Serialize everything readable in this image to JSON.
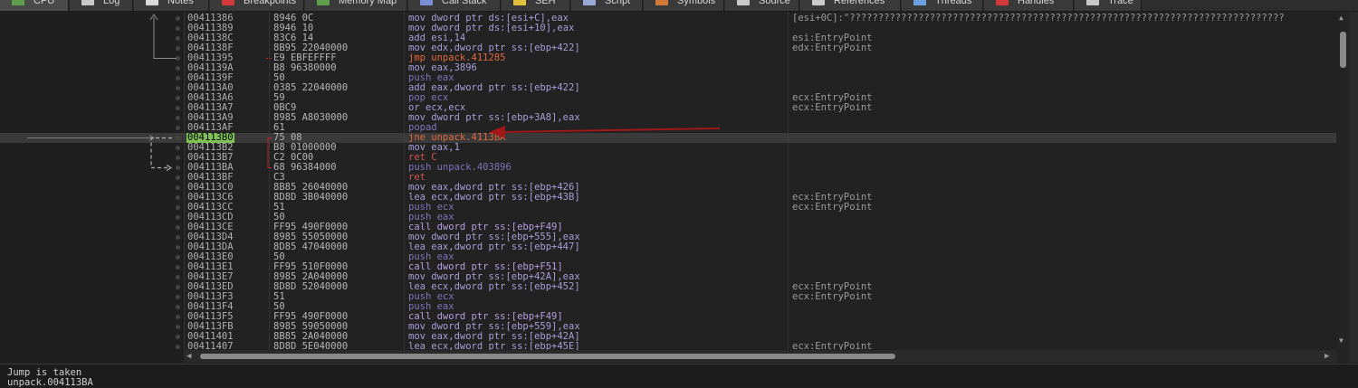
{
  "tabs": [
    {
      "label": "CPU",
      "icon": "cpu-icon",
      "color": "#5fa04e",
      "active": true
    },
    {
      "label": "Log",
      "icon": "log-icon",
      "color": "#c9c9c9",
      "active": false
    },
    {
      "label": "Notes",
      "icon": "notes-icon",
      "color": "#d9d9d9",
      "active": false
    },
    {
      "label": "Breakpoints",
      "icon": "breakpoint-icon",
      "color": "#d23a3a",
      "active": false
    },
    {
      "label": "Memory Map",
      "icon": "memory-map-icon",
      "color": "#5fa04e",
      "active": false
    },
    {
      "label": "Call Stack",
      "icon": "call-stack-icon",
      "color": "#7a8fd6",
      "active": false
    },
    {
      "label": "SEH",
      "icon": "seh-icon",
      "color": "#e2c23a",
      "active": false
    },
    {
      "label": "Script",
      "icon": "script-icon",
      "color": "#9aa8d8",
      "active": false
    },
    {
      "label": "Symbols",
      "icon": "symbols-icon",
      "color": "#d07a3a",
      "active": false
    },
    {
      "label": "Source",
      "icon": "source-icon",
      "color": "#c9c9c9",
      "active": false
    },
    {
      "label": "References",
      "icon": "references-icon",
      "color": "#c9c9c9",
      "active": false
    },
    {
      "label": "Threads",
      "icon": "threads-icon",
      "color": "#6aa0e0",
      "active": false
    },
    {
      "label": "Handles",
      "icon": "handles-icon",
      "color": "#d23a3a",
      "active": false
    },
    {
      "label": "Trace",
      "icon": "trace-icon",
      "color": "#c9c9c9",
      "active": false
    }
  ],
  "eip_label": "EIP",
  "rows": [
    {
      "addr": "00411386",
      "bytes": "8946 0C",
      "instr": "mov dword ptr ds:[esi+C],eax",
      "comment": "[esi+0C]:\"????????????????????????????????????????????????????????????????????????????"
    },
    {
      "addr": "00411389",
      "bytes": "8946 10",
      "instr": "mov dword ptr ds:[esi+10],eax",
      "comment": ""
    },
    {
      "addr": "0041138C",
      "bytes": "83C6 14",
      "instr": "add esi,14",
      "comment": "esi:EntryPoint"
    },
    {
      "addr": "0041138F",
      "bytes": "8B95 22040000",
      "instr": "mov edx,dword ptr ss:[ebp+422]",
      "comment": "edx:EntryPoint"
    },
    {
      "addr": "00411395",
      "bytes": "E9 EBFEFFFF",
      "instr": "jmp unpack.411285",
      "comment": "",
      "kind": "jmp"
    },
    {
      "addr": "0041139A",
      "bytes": "B8 96380000",
      "instr": "mov eax,3896",
      "comment": ""
    },
    {
      "addr": "0041139F",
      "bytes": "50",
      "instr": "push eax",
      "comment": "",
      "kind": "push"
    },
    {
      "addr": "004113A0",
      "bytes": "0385 22040000",
      "instr": "add eax,dword ptr ss:[ebp+422]",
      "comment": ""
    },
    {
      "addr": "004113A6",
      "bytes": "59",
      "instr": "pop ecx",
      "comment": "ecx:EntryPoint",
      "kind": "push"
    },
    {
      "addr": "004113A7",
      "bytes": "0BC9",
      "instr": "or ecx,ecx",
      "comment": "ecx:EntryPoint"
    },
    {
      "addr": "004113A9",
      "bytes": "8985 A8030000",
      "instr": "mov dword ptr ss:[ebp+3A8],eax",
      "comment": ""
    },
    {
      "addr": "004113AF",
      "bytes": "61",
      "instr": "popad",
      "comment": "",
      "kind": "push"
    },
    {
      "addr": "004113B0",
      "bytes": "75 08",
      "instr": "jne unpack.4113BA",
      "comment": "",
      "kind": "jmp",
      "current": true
    },
    {
      "addr": "004113B2",
      "bytes": "B8 01000000",
      "instr": "mov eax,1",
      "comment": ""
    },
    {
      "addr": "004113B7",
      "bytes": "C2 0C00",
      "instr": "ret C",
      "comment": "",
      "kind": "ret"
    },
    {
      "addr": "004113BA",
      "bytes": "68 96384000",
      "instr": "push unpack.403896",
      "comment": "",
      "kind": "push"
    },
    {
      "addr": "004113BF",
      "bytes": "C3",
      "instr": "ret",
      "comment": "",
      "kind": "ret"
    },
    {
      "addr": "004113C0",
      "bytes": "8B85 26040000",
      "instr": "mov eax,dword ptr ss:[ebp+426]",
      "comment": ""
    },
    {
      "addr": "004113C6",
      "bytes": "8D8D 3B040000",
      "instr": "lea ecx,dword ptr ss:[ebp+43B]",
      "comment": "ecx:EntryPoint"
    },
    {
      "addr": "004113CC",
      "bytes": "51",
      "instr": "push ecx",
      "comment": "ecx:EntryPoint",
      "kind": "push"
    },
    {
      "addr": "004113CD",
      "bytes": "50",
      "instr": "push eax",
      "comment": "",
      "kind": "push"
    },
    {
      "addr": "004113CE",
      "bytes": "FF95 490F0000",
      "instr": "call dword ptr ss:[ebp+F49]",
      "comment": "",
      "kind": "call"
    },
    {
      "addr": "004113D4",
      "bytes": "8985 55050000",
      "instr": "mov dword ptr ss:[ebp+555],eax",
      "comment": ""
    },
    {
      "addr": "004113DA",
      "bytes": "8D85 47040000",
      "instr": "lea eax,dword ptr ss:[ebp+447]",
      "comment": ""
    },
    {
      "addr": "004113E0",
      "bytes": "50",
      "instr": "push eax",
      "comment": "",
      "kind": "push"
    },
    {
      "addr": "004113E1",
      "bytes": "FF95 510F0000",
      "instr": "call dword ptr ss:[ebp+F51]",
      "comment": "",
      "kind": "call"
    },
    {
      "addr": "004113E7",
      "bytes": "8985 2A040000",
      "instr": "mov dword ptr ss:[ebp+42A],eax",
      "comment": ""
    },
    {
      "addr": "004113ED",
      "bytes": "8D8D 52040000",
      "instr": "lea ecx,dword ptr ss:[ebp+452]",
      "comment": "ecx:EntryPoint"
    },
    {
      "addr": "004113F3",
      "bytes": "51",
      "instr": "push ecx",
      "comment": "ecx:EntryPoint",
      "kind": "push"
    },
    {
      "addr": "004113F4",
      "bytes": "50",
      "instr": "push eax",
      "comment": "",
      "kind": "push"
    },
    {
      "addr": "004113F5",
      "bytes": "FF95 490F0000",
      "instr": "call dword ptr ss:[ebp+F49]",
      "comment": "",
      "kind": "call"
    },
    {
      "addr": "004113FB",
      "bytes": "8985 59050000",
      "instr": "mov dword ptr ss:[ebp+559],eax",
      "comment": ""
    },
    {
      "addr": "00411401",
      "bytes": "8B85 2A040000",
      "instr": "mov eax,dword ptr ss:[ebp+42A]",
      "comment": ""
    },
    {
      "addr": "00411407",
      "bytes": "8D8D 5E040000",
      "instr": "lea ecx,dword ptr ss:[ebp+45E]",
      "comment": "ecx:EntryPoint"
    }
  ],
  "info_lines": [
    "Jump is taken",
    "unpack.004113BA"
  ],
  "colors": {
    "eip_highlight": "#7ec256",
    "jump_arrow": "#c0262a",
    "annotation_arrow": "#a01818"
  }
}
